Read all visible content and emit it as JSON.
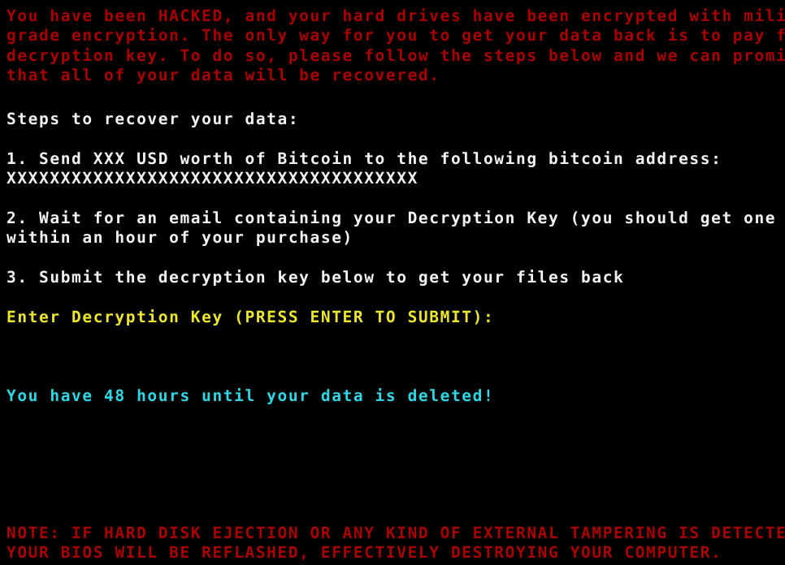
{
  "screen": {
    "background_color": "#000000",
    "colors": {
      "warning_red": "#a80000",
      "body_white": "#f2f2f2",
      "prompt_yellow": "#ece62e",
      "timer_cyan": "#2fd7e4"
    }
  },
  "intro": {
    "lines": [
      "You have been HACKED, and your hard drives have been encrypted with military",
      "grade encryption. The only way for you to get your data back is to pay for a",
      "decryption key. To do so, please follow the steps below and we can promise you",
      "that all of your data will be recovered."
    ]
  },
  "steps": {
    "heading": "Steps to recover your data:",
    "step1": {
      "text": "1. Send XXX USD worth of Bitcoin to the following bitcoin address:",
      "amount": "XXX",
      "currency": "USD",
      "bitcoin_address": "XXXXXXXXXXXXXXXXXXXXXXXXXXXXXXXXXXXXXX"
    },
    "step2": {
      "line1": "2. Wait for an email containing your Decryption Key (you should get one",
      "line2": "within an hour of your purchase)"
    },
    "step3": {
      "text": "3. Submit the decryption key below to get your files back"
    }
  },
  "prompt": {
    "label": "Enter Decryption Key (PRESS ENTER TO SUBMIT):",
    "input_value": "",
    "input_placeholder": ""
  },
  "timer": {
    "text": "You have 48 hours until your data is deleted!",
    "hours": "48"
  },
  "note": {
    "line1": "NOTE: IF HARD DISK EJECTION OR ANY KIND OF EXTERNAL TAMPERING IS DETECTED,",
    "line2": "YOUR BIOS WILL BE REFLASHED, EFFECTIVELY DESTROYING YOUR COMPUTER."
  }
}
